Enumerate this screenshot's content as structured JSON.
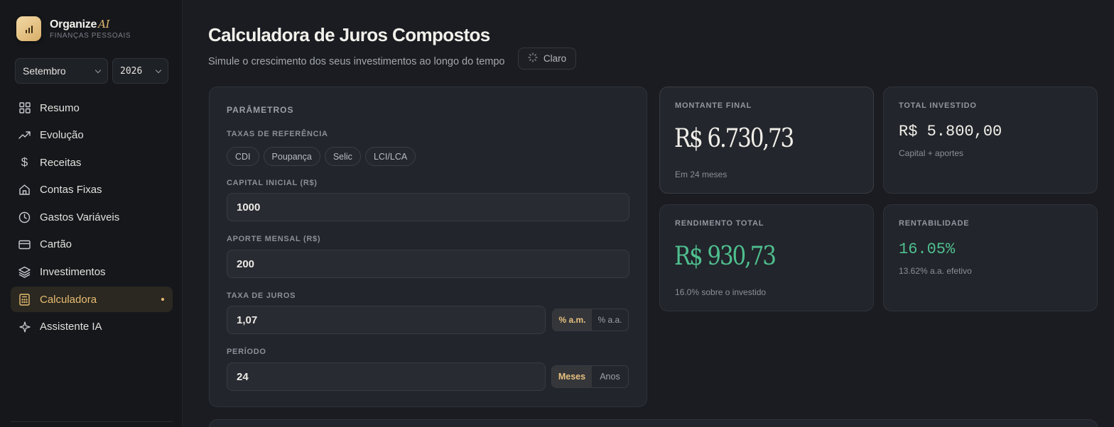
{
  "brand": {
    "name": "Organize",
    "ai": "AI",
    "subtitle": "FINANÇAS PESSOAIS"
  },
  "filters": {
    "month": "Setembro",
    "year": "2026"
  },
  "nav": [
    {
      "label": "Resumo",
      "icon": "grid-icon"
    },
    {
      "label": "Evolução",
      "icon": "trending-up-icon"
    },
    {
      "label": "Receitas",
      "icon": "dollar-icon"
    },
    {
      "label": "Contas Fixas",
      "icon": "home-icon"
    },
    {
      "label": "Gastos Variáveis",
      "icon": "clock-icon"
    },
    {
      "label": "Cartão",
      "icon": "credit-card-icon"
    },
    {
      "label": "Investimentos",
      "icon": "layers-icon"
    },
    {
      "label": "Calculadora",
      "icon": "calculator-icon",
      "active": true
    },
    {
      "label": "Assistente IA",
      "icon": "sparkle-icon"
    }
  ],
  "header": {
    "title": "Calculadora de Juros Compostos",
    "subtitle": "Simule o crescimento dos seus investimentos ao longo do tempo",
    "theme_button": "Claro"
  },
  "params": {
    "title": "PARÂMETROS",
    "ref_label": "TAXAS DE REFERÊNCIA",
    "ref_chips": [
      "CDI",
      "Poupança",
      "Selic",
      "LCI/LCA"
    ],
    "capital_label": "CAPITAL INICIAL (R$)",
    "capital_value": "1000",
    "aporte_label": "APORTE MENSAL (R$)",
    "aporte_value": "200",
    "taxa_label": "TAXA DE JUROS",
    "taxa_value": "1,07",
    "taxa_units": [
      "% a.m.",
      "% a.a."
    ],
    "periodo_label": "PERÍODO",
    "periodo_value": "24",
    "periodo_units": [
      "Meses",
      "Anos"
    ]
  },
  "stats": {
    "montante": {
      "label": "MONTANTE FINAL",
      "value": "R$ 6.730,73",
      "note": "Em 24 meses"
    },
    "investido": {
      "label": "TOTAL INVESTIDO",
      "value": "R$ 5.800,00",
      "note": "Capital + aportes"
    },
    "rendimento": {
      "label": "RENDIMENTO TOTAL",
      "value": "R$ 930,73",
      "note": "16.0% sobre o investido"
    },
    "rentabilidade": {
      "label": "RENTABILIDADE",
      "value": "16.05%",
      "note": "13.62% a.a. efetivo"
    }
  },
  "colors": {
    "accent": "#e9bd72",
    "positive": "#4fbf8f",
    "background": "#1a1c21"
  }
}
